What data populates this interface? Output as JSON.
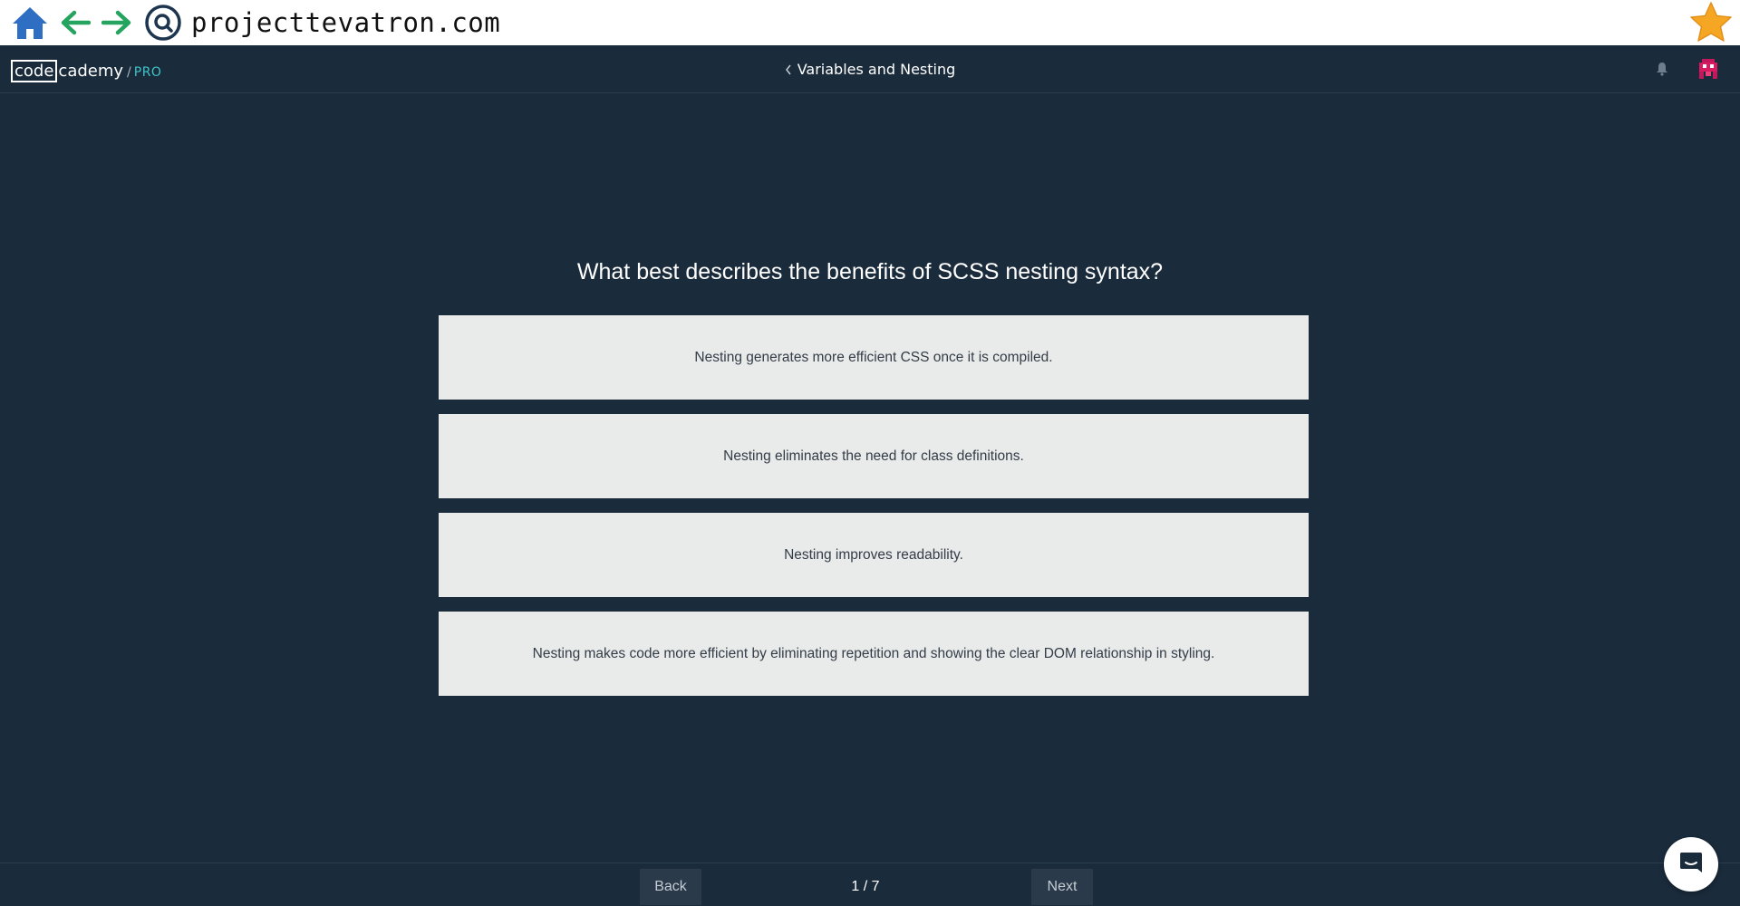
{
  "browser": {
    "url": "projecttevatron.com",
    "icons": [
      "home-icon",
      "back-arrow-icon",
      "forward-arrow-icon",
      "search-icon",
      "star-icon"
    ],
    "colors": {
      "home": "#2f6fc3",
      "arrows": "#25a45f",
      "star": "#f5a623"
    }
  },
  "header": {
    "logo_code": "code",
    "logo_cademy": "cademy",
    "logo_slash": "/",
    "logo_pro": "PRO",
    "lesson_title": "Variables and Nesting"
  },
  "quiz": {
    "question": "What best describes the benefits of SCSS nesting syntax?",
    "options": [
      "Nesting generates more efficient CSS once it is compiled.",
      "Nesting eliminates the need for class definitions.",
      "Nesting improves readability.",
      "Nesting makes code more efficient by eliminating repetition and showing the clear DOM relationship in styling."
    ]
  },
  "footer": {
    "back_label": "Back",
    "next_label": "Next",
    "page_indicator": "1 / 7"
  },
  "colors": {
    "app_bg": "#1a2b3b",
    "option_bg": "#e9eaea",
    "pro_accent": "#3fc4c8"
  }
}
